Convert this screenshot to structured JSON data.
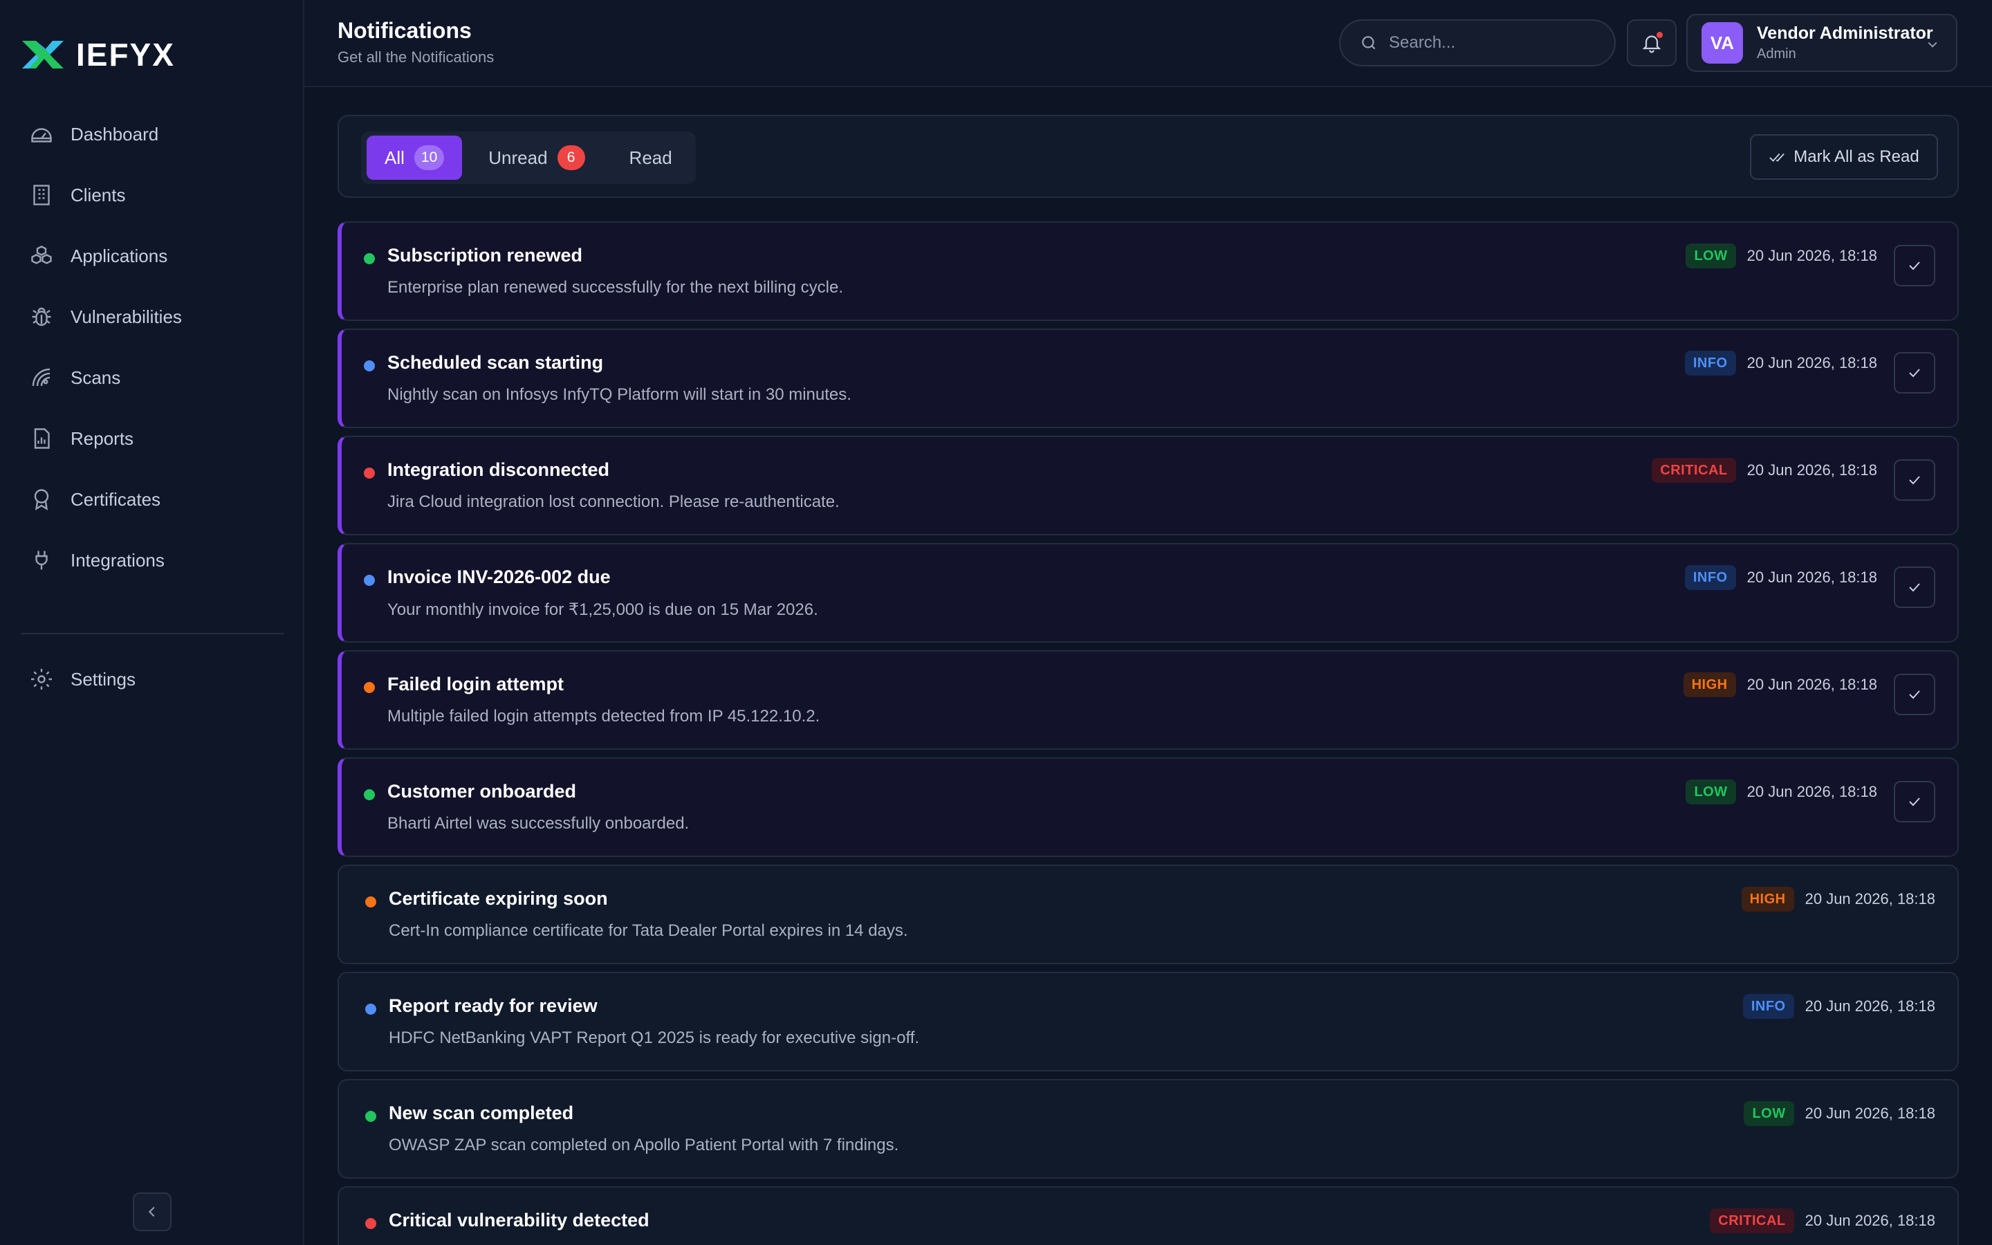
{
  "brand": {
    "name": "IEFYX"
  },
  "sidebar": {
    "items": [
      {
        "label": "Dashboard",
        "icon": "dashboard-gauge-icon"
      },
      {
        "label": "Clients",
        "icon": "building-icon"
      },
      {
        "label": "Applications",
        "icon": "cubes-icon"
      },
      {
        "label": "Vulnerabilities",
        "icon": "bug-icon"
      },
      {
        "label": "Scans",
        "icon": "radar-icon"
      },
      {
        "label": "Reports",
        "icon": "report-chart-icon"
      },
      {
        "label": "Certificates",
        "icon": "award-icon"
      },
      {
        "label": "Integrations",
        "icon": "plug-icon"
      }
    ],
    "settings": {
      "label": "Settings",
      "icon": "gear-icon"
    }
  },
  "header": {
    "title": "Notifications",
    "subtitle": "Get all the Notifications",
    "search_placeholder": "Search...",
    "user": {
      "initials": "VA",
      "name": "Vendor Administrator",
      "role": "Admin"
    }
  },
  "filters": {
    "tabs": [
      {
        "label": "All",
        "count": "10",
        "active": true
      },
      {
        "label": "Unread",
        "count": "6",
        "active": false
      },
      {
        "label": "Read",
        "active": false
      }
    ],
    "mark_all_label": "Mark All as Read"
  },
  "notifications": [
    {
      "title": "Subscription renewed",
      "description": "Enterprise plan renewed successfully for the next billing cycle.",
      "severity": "LOW",
      "time": "20 Jun 2026, 18:18",
      "unread": true
    },
    {
      "title": "Scheduled scan starting",
      "description": "Nightly scan on Infosys InfyTQ Platform will start in 30 minutes.",
      "severity": "INFO",
      "time": "20 Jun 2026, 18:18",
      "unread": true
    },
    {
      "title": "Integration disconnected",
      "description": "Jira Cloud integration lost connection. Please re-authenticate.",
      "severity": "CRITICAL",
      "time": "20 Jun 2026, 18:18",
      "unread": true
    },
    {
      "title": "Invoice INV-2026-002 due",
      "description": "Your monthly invoice for ₹1,25,000 is due on 15 Mar 2026.",
      "severity": "INFO",
      "time": "20 Jun 2026, 18:18",
      "unread": true
    },
    {
      "title": "Failed login attempt",
      "description": "Multiple failed login attempts detected from IP 45.122.10.2.",
      "severity": "HIGH",
      "time": "20 Jun 2026, 18:18",
      "unread": true
    },
    {
      "title": "Customer onboarded",
      "description": "Bharti Airtel was successfully onboarded.",
      "severity": "LOW",
      "time": "20 Jun 2026, 18:18",
      "unread": true
    },
    {
      "title": "Certificate expiring soon",
      "description": "Cert-In compliance certificate for Tata Dealer Portal expires in 14 days.",
      "severity": "HIGH",
      "time": "20 Jun 2026, 18:18",
      "unread": false
    },
    {
      "title": "Report ready for review",
      "description": "HDFC NetBanking VAPT Report Q1 2025 is ready for executive sign-off.",
      "severity": "INFO",
      "time": "20 Jun 2026, 18:18",
      "unread": false
    },
    {
      "title": "New scan completed",
      "description": "OWASP ZAP scan completed on Apollo Patient Portal with 7 findings.",
      "severity": "LOW",
      "time": "20 Jun 2026, 18:18",
      "unread": false
    },
    {
      "title": "Critical vulnerability detected",
      "description": "",
      "severity": "CRITICAL",
      "time": "20 Jun 2026, 18:18",
      "unread": false
    }
  ],
  "colors": {
    "accent": "#7c3aed",
    "low": "#22c55e",
    "info": "#4f8ff7",
    "high": "#f97316",
    "critical": "#ef4444"
  }
}
